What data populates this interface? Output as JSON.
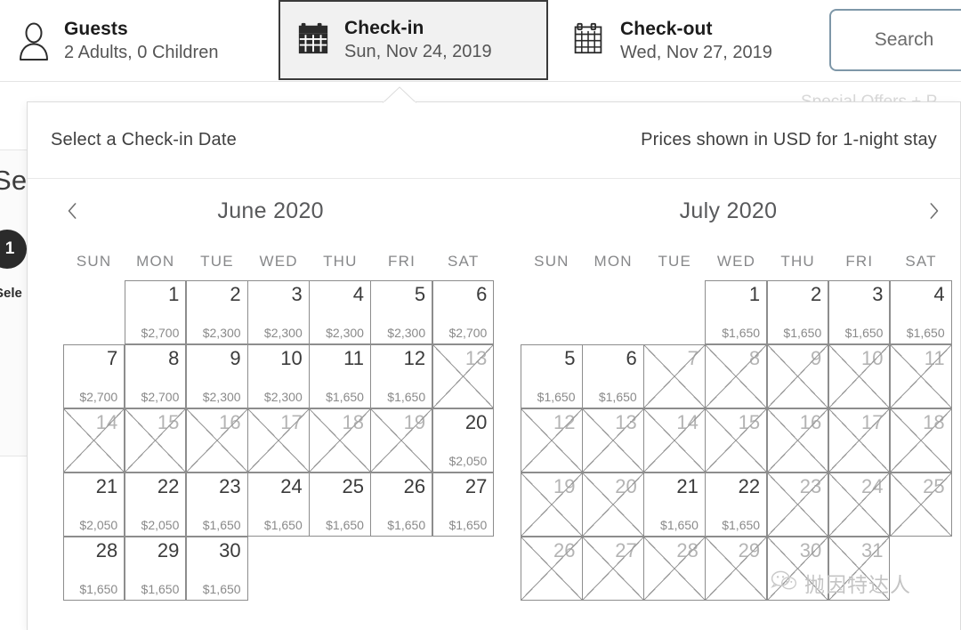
{
  "topbar": {
    "guests": {
      "icon": "person-icon",
      "label": "Guests",
      "value": "2 Adults, 0 Children"
    },
    "checkin": {
      "icon": "calendar-filled-icon",
      "label": "Check-in",
      "value": "Sun, Nov 24, 2019"
    },
    "checkout": {
      "icon": "calendar-outline-icon",
      "label": "Check-out",
      "value": "Wed, Nov 27, 2019"
    },
    "search_label": "Search"
  },
  "panel": {
    "title": "Select a Check-in Date",
    "note": "Prices shown in USD for 1-night stay",
    "prev_arrow": "‹",
    "next_arrow": "›"
  },
  "background": {
    "partial_heading": "Se",
    "badge_number": "1",
    "partial_step_label": "Sele",
    "ghost_top_text": "Special Offers + P"
  },
  "weekdays": [
    "SUN",
    "MON",
    "TUE",
    "WED",
    "THU",
    "FRI",
    "SAT"
  ],
  "months": [
    {
      "name": "June 2020",
      "lead_blanks": 1,
      "days": [
        {
          "day": "1",
          "price": "$2,700",
          "blocked": false
        },
        {
          "day": "2",
          "price": "$2,300",
          "blocked": false
        },
        {
          "day": "3",
          "price": "$2,300",
          "blocked": false
        },
        {
          "day": "4",
          "price": "$2,300",
          "blocked": false
        },
        {
          "day": "5",
          "price": "$2,300",
          "blocked": false
        },
        {
          "day": "6",
          "price": "$2,700",
          "blocked": false
        },
        {
          "day": "7",
          "price": "$2,700",
          "blocked": false
        },
        {
          "day": "8",
          "price": "$2,700",
          "blocked": false
        },
        {
          "day": "9",
          "price": "$2,300",
          "blocked": false
        },
        {
          "day": "10",
          "price": "$2,300",
          "blocked": false
        },
        {
          "day": "11",
          "price": "$1,650",
          "blocked": false
        },
        {
          "day": "12",
          "price": "$1,650",
          "blocked": false
        },
        {
          "day": "13",
          "price": "",
          "blocked": true
        },
        {
          "day": "14",
          "price": "",
          "blocked": true
        },
        {
          "day": "15",
          "price": "",
          "blocked": true
        },
        {
          "day": "16",
          "price": "",
          "blocked": true
        },
        {
          "day": "17",
          "price": "",
          "blocked": true
        },
        {
          "day": "18",
          "price": "",
          "blocked": true
        },
        {
          "day": "19",
          "price": "",
          "blocked": true
        },
        {
          "day": "20",
          "price": "$2,050",
          "blocked": false
        },
        {
          "day": "21",
          "price": "$2,050",
          "blocked": false
        },
        {
          "day": "22",
          "price": "$2,050",
          "blocked": false
        },
        {
          "day": "23",
          "price": "$1,650",
          "blocked": false
        },
        {
          "day": "24",
          "price": "$1,650",
          "blocked": false
        },
        {
          "day": "25",
          "price": "$1,650",
          "blocked": false
        },
        {
          "day": "26",
          "price": "$1,650",
          "blocked": false
        },
        {
          "day": "27",
          "price": "$1,650",
          "blocked": false
        },
        {
          "day": "28",
          "price": "$1,650",
          "blocked": false
        },
        {
          "day": "29",
          "price": "$1,650",
          "blocked": false
        },
        {
          "day": "30",
          "price": "$1,650",
          "blocked": false
        }
      ]
    },
    {
      "name": "July 2020",
      "lead_blanks": 3,
      "days": [
        {
          "day": "1",
          "price": "$1,650",
          "blocked": false
        },
        {
          "day": "2",
          "price": "$1,650",
          "blocked": false
        },
        {
          "day": "3",
          "price": "$1,650",
          "blocked": false
        },
        {
          "day": "4",
          "price": "$1,650",
          "blocked": false
        },
        {
          "day": "5",
          "price": "$1,650",
          "blocked": false
        },
        {
          "day": "6",
          "price": "$1,650",
          "blocked": false
        },
        {
          "day": "7",
          "price": "",
          "blocked": true
        },
        {
          "day": "8",
          "price": "",
          "blocked": true
        },
        {
          "day": "9",
          "price": "",
          "blocked": true
        },
        {
          "day": "10",
          "price": "",
          "blocked": true
        },
        {
          "day": "11",
          "price": "",
          "blocked": true
        },
        {
          "day": "12",
          "price": "",
          "blocked": true
        },
        {
          "day": "13",
          "price": "",
          "blocked": true
        },
        {
          "day": "14",
          "price": "",
          "blocked": true
        },
        {
          "day": "15",
          "price": "",
          "blocked": true
        },
        {
          "day": "16",
          "price": "",
          "blocked": true
        },
        {
          "day": "17",
          "price": "",
          "blocked": true
        },
        {
          "day": "18",
          "price": "",
          "blocked": true
        },
        {
          "day": "19",
          "price": "",
          "blocked": true
        },
        {
          "day": "20",
          "price": "",
          "blocked": true
        },
        {
          "day": "21",
          "price": "$1,650",
          "blocked": false
        },
        {
          "day": "22",
          "price": "$1,650",
          "blocked": false
        },
        {
          "day": "23",
          "price": "",
          "blocked": true
        },
        {
          "day": "24",
          "price": "",
          "blocked": true
        },
        {
          "day": "25",
          "price": "",
          "blocked": true
        },
        {
          "day": "26",
          "price": "",
          "blocked": true
        },
        {
          "day": "27",
          "price": "",
          "blocked": true
        },
        {
          "day": "28",
          "price": "",
          "blocked": true
        },
        {
          "day": "29",
          "price": "",
          "blocked": true
        },
        {
          "day": "30",
          "price": "",
          "blocked": true
        },
        {
          "day": "31",
          "price": "",
          "blocked": true
        }
      ]
    }
  ],
  "watermark": {
    "icon": "wechat-icon",
    "text": "抛因特达人"
  },
  "colors": {
    "accent_border": "#7e97a8",
    "active_tab_bg": "#f1f1f1",
    "active_tab_border": "#3a3a3a",
    "grid_line": "#8d8d8d",
    "blocked_line": "#9a9a9a",
    "price_text": "#8a8a8a"
  }
}
